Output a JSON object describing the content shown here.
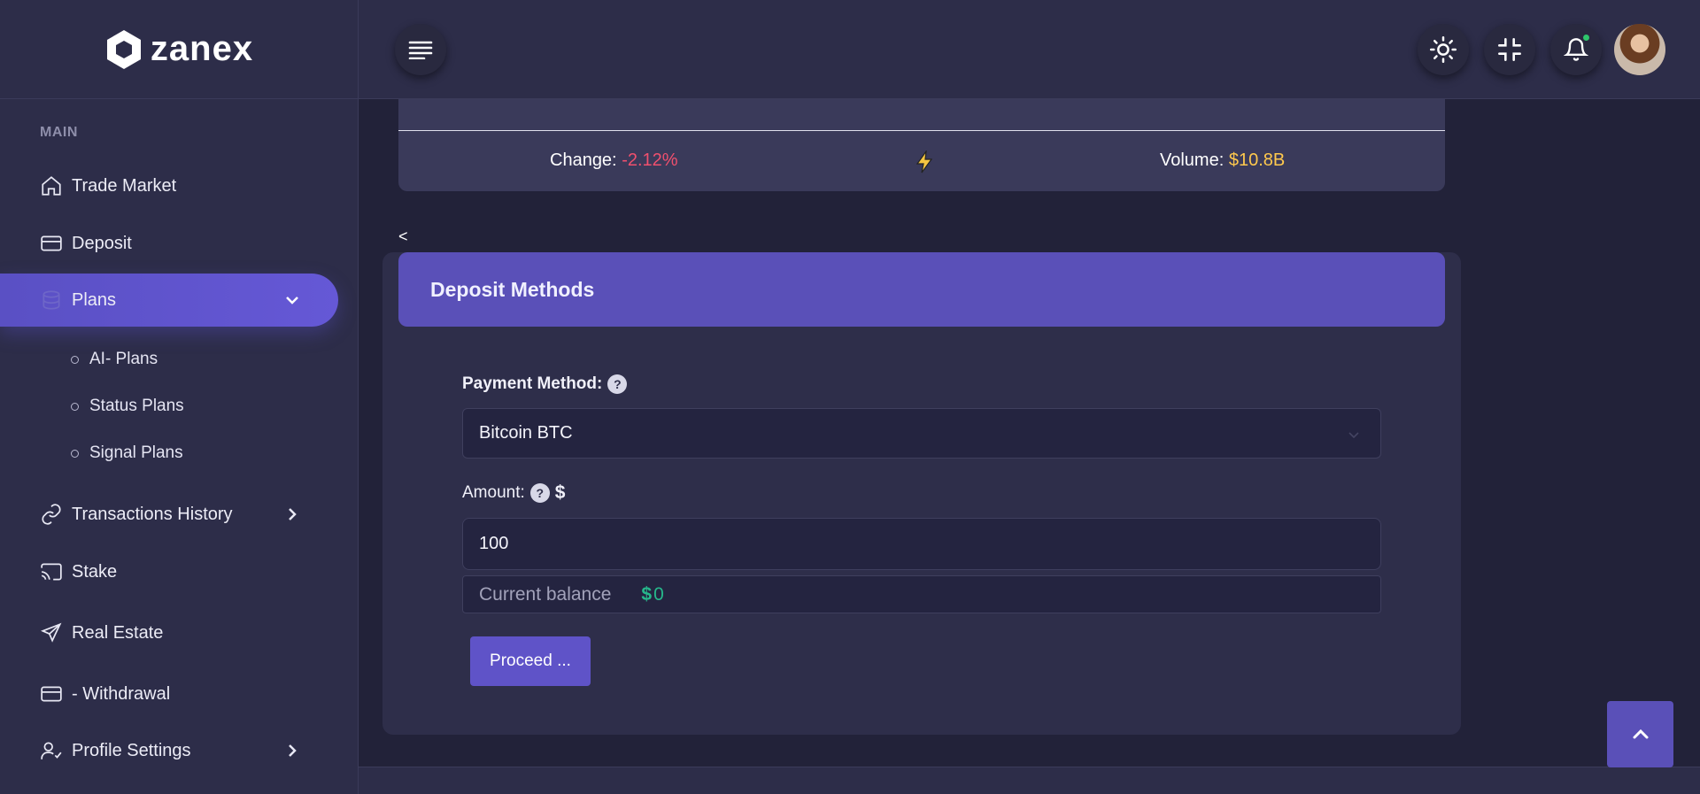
{
  "brand": {
    "name": "zanex"
  },
  "sidebar": {
    "section_title": "MAIN",
    "items": [
      {
        "label": "Trade Market",
        "icon": "home-icon"
      },
      {
        "label": "Deposit",
        "icon": "card-icon"
      },
      {
        "label": "Plans",
        "icon": "database-icon",
        "active": true,
        "expanded": true
      },
      {
        "label": "Transactions History",
        "icon": "link-icon"
      },
      {
        "label": "Stake",
        "icon": "cast-icon"
      },
      {
        "label": "Real Estate",
        "icon": "send-icon"
      },
      {
        "label": "- Withdrawal",
        "icon": "card-icon"
      },
      {
        "label": "Profile Settings",
        "icon": "user-check-icon"
      }
    ],
    "plans_sub": [
      "AI- Plans",
      "Status Plans",
      "Signal Plans"
    ]
  },
  "ticker": {
    "change_label": "Change:",
    "change_value": "-2.12%",
    "volume_label": "Volume:",
    "volume_value": "$10.8B"
  },
  "back_link": "<",
  "deposit": {
    "title": "Deposit Methods",
    "payment_label": "Payment Method:",
    "payment_selected": "Bitcoin BTC",
    "amount_label": "Amount:",
    "amount_value": "100",
    "balance_label": "Current balance",
    "balance_value": "0",
    "proceed_label": "Proceed ..."
  },
  "colors": {
    "accent": "#5a50b8",
    "negative": "#f0506e",
    "volume": "#ffc94d",
    "balance": "#26b88b"
  }
}
